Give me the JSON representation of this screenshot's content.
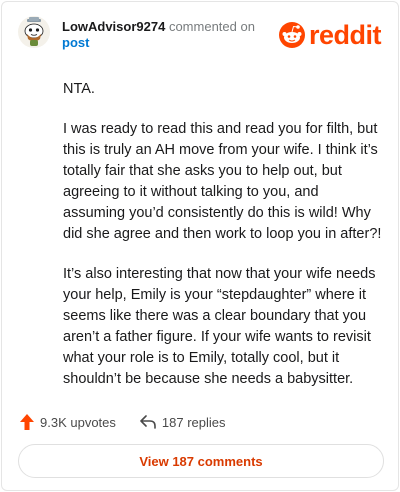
{
  "comment": {
    "username": "LowAdvisor9274",
    "commented_text": "commented on",
    "post_link": "post",
    "paragraphs": [
      "NTA.",
      "I was ready to read this and read you for filth, but this is truly an AH move from your wife. I think it’s totally fair that she asks you to help out, but agreeing to it without talking to you, and assuming you’d consistently do this is wild! Why did she agree and then work to loop you in after?!",
      "It’s also interesting that now that your wife needs your help, Emily is your “stepdaughter” where it seems like there was a clear boundary that you aren’t a father figure. If your wife wants to revisit what your role is to Emily, totally cool, but it shouldn’t be because she needs a babysitter."
    ]
  },
  "brand": {
    "logo_text": "reddit",
    "accent_color": "#ff4500"
  },
  "actions": {
    "upvotes_label": "9.3K upvotes",
    "replies_label": "187 replies",
    "upvote_color": "#ff4500"
  },
  "footer": {
    "view_comments_label": "View 187 comments"
  }
}
